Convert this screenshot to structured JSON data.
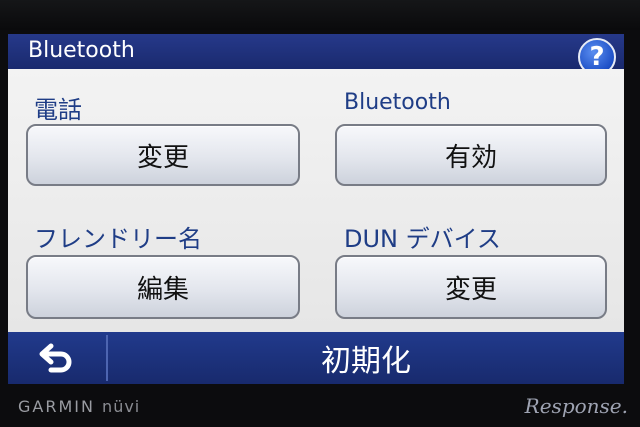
{
  "title_bar": {
    "title": "Bluetooth",
    "help_label": "?"
  },
  "settings": [
    {
      "label": "電話",
      "button": "変更"
    },
    {
      "label": "Bluetooth",
      "button": "有効"
    },
    {
      "label": "フレンドリー名",
      "button": "編集"
    },
    {
      "label": "DUN デバイス",
      "button": "変更"
    }
  ],
  "bottom_bar": {
    "reset_label": "初期化"
  },
  "device": {
    "brand": "GARMIN",
    "model": "nüvi"
  },
  "watermark": "Response."
}
